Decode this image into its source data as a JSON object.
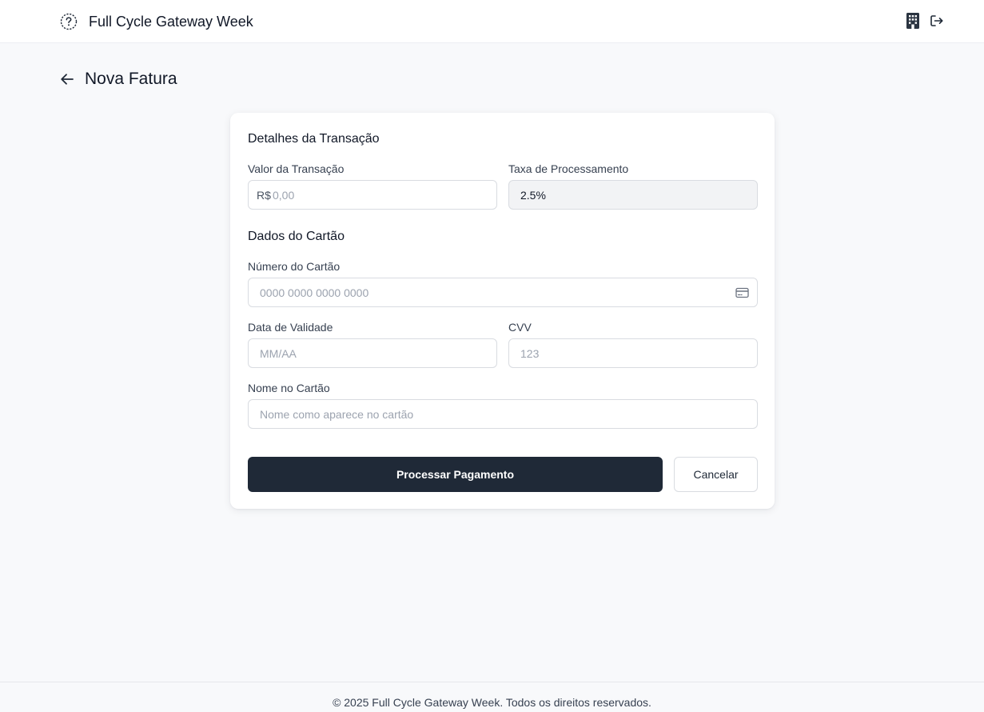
{
  "app": {
    "title": "Full Cycle Gateway Week"
  },
  "header": {
    "brand_icon": "help-circle-icon",
    "right_icons": [
      "building-icon",
      "logout-icon"
    ]
  },
  "page": {
    "back_icon": "arrow-left-icon",
    "title": "Nova Fatura"
  },
  "transaction": {
    "section_title": "Detalhes da Transação",
    "amount": {
      "label": "Valor da Transação",
      "prefix": "R$",
      "placeholder": "0,00",
      "value": ""
    },
    "fee": {
      "label": "Taxa de Processamento",
      "value": "2.5%"
    }
  },
  "card": {
    "section_title": "Dados do Cartão",
    "number": {
      "label": "Número do Cartão",
      "placeholder": "0000 0000 0000 0000",
      "icon": "credit-card-icon"
    },
    "expiry": {
      "label": "Data de Validade",
      "placeholder": "MM/AA"
    },
    "cvv": {
      "label": "CVV",
      "placeholder": "123"
    },
    "name": {
      "label": "Nome no Cartão",
      "placeholder": "Nome como aparece no cartão"
    }
  },
  "actions": {
    "submit_label": "Processar Pagamento",
    "cancel_label": "Cancelar"
  },
  "footer": {
    "text": "© 2025 Full Cycle Gateway Week. Todos os direitos reservados."
  },
  "colors": {
    "primary": "#1f2937",
    "background": "#f8f9fb",
    "border": "#d9dce1"
  }
}
